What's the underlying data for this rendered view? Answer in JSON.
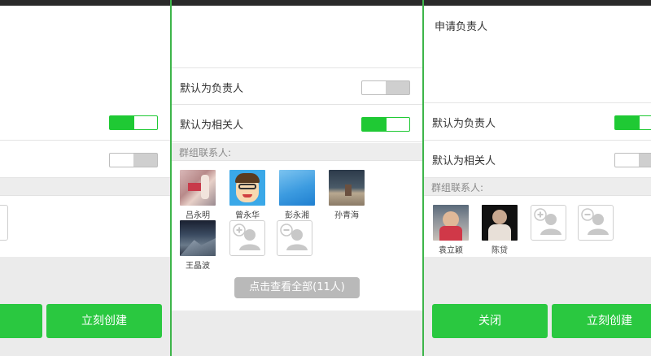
{
  "left": {
    "title_label": "",
    "rows": [
      {
        "label": "",
        "toggle": "on"
      },
      {
        "label": "",
        "toggle": "off"
      }
    ],
    "create_label": "立刻创建"
  },
  "middle": {
    "rows": [
      {
        "label": "默认为负责人",
        "toggle": "off"
      },
      {
        "label": "默认为相关人",
        "toggle": "on"
      }
    ],
    "section_label": "群组联系人:",
    "members": [
      "吕永明",
      "曾永华",
      "彭永湘",
      "孙青海",
      "王晶波"
    ],
    "view_all_label": "点击查看全部(11人)"
  },
  "right": {
    "title_label": "申请负责人",
    "rows": [
      {
        "label": "默认为负责人",
        "toggle": "on"
      },
      {
        "label": "默认为相关人",
        "toggle": "off"
      }
    ],
    "section_label": "群组联系人:",
    "members": [
      "袁立颖",
      "陈贷"
    ],
    "close_label": "关闭",
    "create_label": "立刻创建"
  },
  "colors": {
    "accent_green": "#2ac840",
    "divider_green": "#3db54a",
    "toggle_on": "#1fc934"
  },
  "icons": [
    "add-member-icon",
    "remove-member-icon"
  ]
}
